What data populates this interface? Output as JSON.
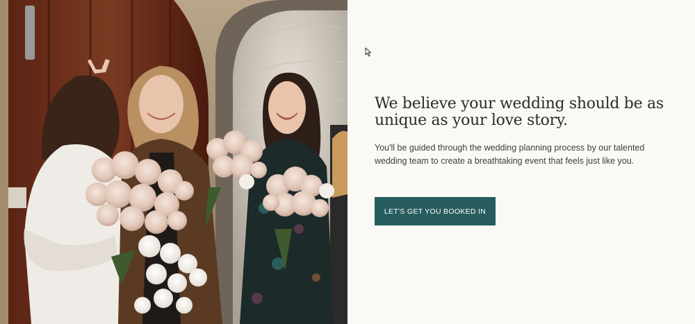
{
  "hero_section": {
    "photo": {
      "alt_description": "Bride and bridesmaids holding bouquets of blush roses in front of a wooden church door"
    },
    "headline": "We believe your wedding should be as unique as your love story.",
    "intro": "You'll be guided through the wedding planning process by our talented wedding team to create a breathtaking event that feels just like you.",
    "cta_label": "LET'S GET YOU BOOKED IN"
  },
  "colors": {
    "accent": "#275d5f",
    "background": "#fbf9f6",
    "headline_text": "#2b2b2b",
    "body_text": "#3d3d3d"
  },
  "icons": {
    "cursor": "mouse-pointer-icon"
  }
}
